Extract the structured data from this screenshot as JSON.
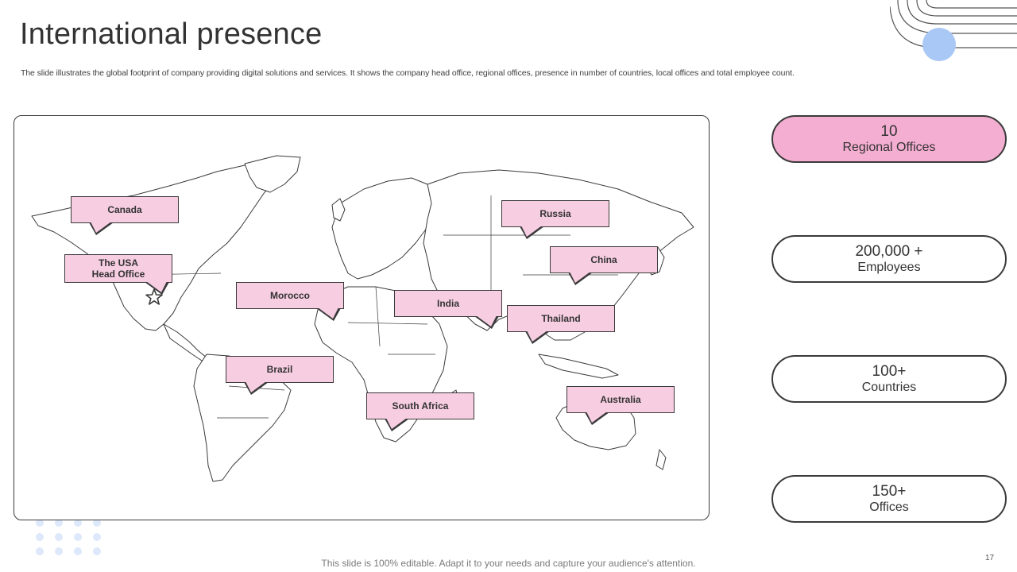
{
  "slide": {
    "title": "International presence",
    "subtitle": "The slide illustrates the global footprint of company providing digital solutions and services. It shows the company head office, regional offices, presence in number of countries, local offices and total employee count.",
    "footer": "This slide is 100% editable. Adapt it to your needs and capture your audience's attention.",
    "page_number": "17"
  },
  "map": {
    "callouts": [
      {
        "name": "Canada",
        "label": "Canada"
      },
      {
        "name": "USA",
        "label": "The USA\nHead Office"
      },
      {
        "name": "Morocco",
        "label": "Morocco"
      },
      {
        "name": "Brazil",
        "label": "Brazil"
      },
      {
        "name": "South Africa",
        "label": "South Africa"
      },
      {
        "name": "India",
        "label": "India"
      },
      {
        "name": "Russia",
        "label": "Russia"
      },
      {
        "name": "China",
        "label": "China"
      },
      {
        "name": "Thailand",
        "label": "Thailand"
      },
      {
        "name": "Australia",
        "label": "Australia"
      }
    ],
    "head_office_icon": "star-icon"
  },
  "stats": [
    {
      "value": "10",
      "label": "Regional Offices",
      "highlighted": true
    },
    {
      "value": "200,000 +",
      "label": "Employees",
      "highlighted": false
    },
    {
      "value": "100+",
      "label": "Countries",
      "highlighted": false
    },
    {
      "value": "150+",
      "label": "Offices",
      "highlighted": false
    }
  ],
  "colors": {
    "callout_fill": "#f7cde2",
    "highlight_fill": "#f4aed1",
    "outline": "#3a3a3a",
    "accent_circle": "#a9c8f5",
    "dot_color": "#dde8fb"
  }
}
